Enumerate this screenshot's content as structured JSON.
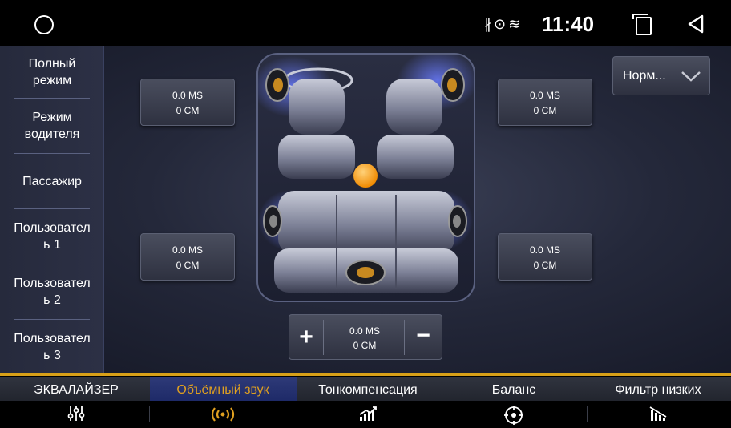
{
  "status_bar": {
    "time": "11:40",
    "indicators": [
      "bluetooth-icon",
      "location-icon",
      "wifi-icon"
    ]
  },
  "sidebar": {
    "items": [
      {
        "label": "Полный\nрежим"
      },
      {
        "label": "Режим\nводителя"
      },
      {
        "label": "Пассажир"
      },
      {
        "label": "Пользовател\nь 1"
      },
      {
        "label": "Пользовател\nь 2"
      },
      {
        "label": "Пользовател\nь 3"
      }
    ]
  },
  "delays": {
    "front_left": {
      "ms": "0.0 MS",
      "cm": "0 CM"
    },
    "front_right": {
      "ms": "0.0 MS",
      "cm": "0 CM"
    },
    "rear_left": {
      "ms": "0.0 MS",
      "cm": "0 CM"
    },
    "rear_right": {
      "ms": "0.0 MS",
      "cm": "0 CM"
    },
    "center": {
      "ms": "0.0 MS",
      "cm": "0 CM"
    }
  },
  "mode_select": {
    "value": "Норм..."
  },
  "stepper": {
    "plus": "+",
    "minus": "−"
  },
  "tabs": [
    {
      "label": "ЭКВАЛАЙЗЕР",
      "icon": "equalizer-icon",
      "active": false
    },
    {
      "label": "Объёмный звук",
      "icon": "surround-icon",
      "active": true
    },
    {
      "label": "Тонкомпенсация",
      "icon": "loudness-icon",
      "active": false
    },
    {
      "label": "Баланс",
      "icon": "balance-icon",
      "active": false
    },
    {
      "label": "Фильтр низких",
      "icon": "lowpass-icon",
      "active": false
    }
  ],
  "colors": {
    "accent": "#e0a020",
    "active_tab": "#24307a",
    "focus_dot": "#ff9e1a",
    "glow": "#5a6cff"
  }
}
